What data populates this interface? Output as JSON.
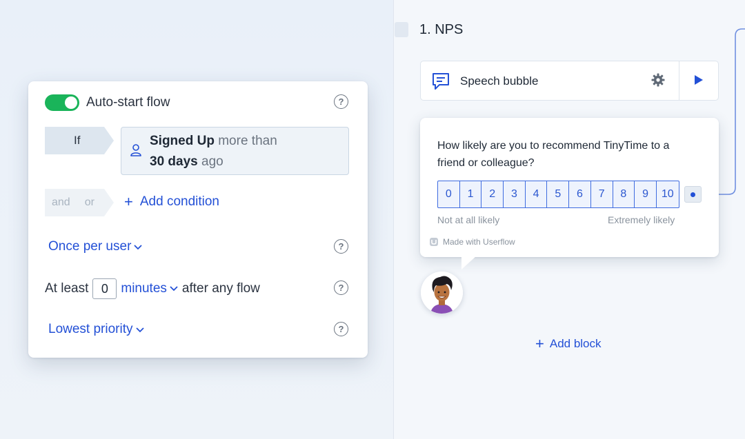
{
  "trigger": {
    "autostart_label": "Auto-start flow",
    "autostart_enabled": true,
    "if_label": "If",
    "condition": {
      "event": "Signed Up",
      "comparator": "more than",
      "amount": "30 days",
      "suffix": "ago"
    },
    "and_label": "and",
    "or_label": "or",
    "add_condition_label": "Add condition",
    "frequency_label": "Once per user",
    "atleast_prefix": "At least",
    "atleast_value": "0",
    "atleast_unit": "minutes",
    "atleast_suffix": "after any flow",
    "priority_label": "Lowest priority",
    "help_glyph": "?"
  },
  "step": {
    "title": "1. NPS",
    "block_label": "Speech bubble",
    "question": "How likely are you to recommend TinyTime to a friend or colleague?",
    "scale": [
      "0",
      "1",
      "2",
      "3",
      "4",
      "5",
      "6",
      "7",
      "8",
      "9",
      "10"
    ],
    "scale_low_label": "Not at all likely",
    "scale_high_label": "Extremely likely",
    "made_with": "Made with Userflow",
    "add_block_label": "Add block"
  },
  "colors": {
    "accent": "#2350d6",
    "toggle_on": "#1ab45a"
  }
}
